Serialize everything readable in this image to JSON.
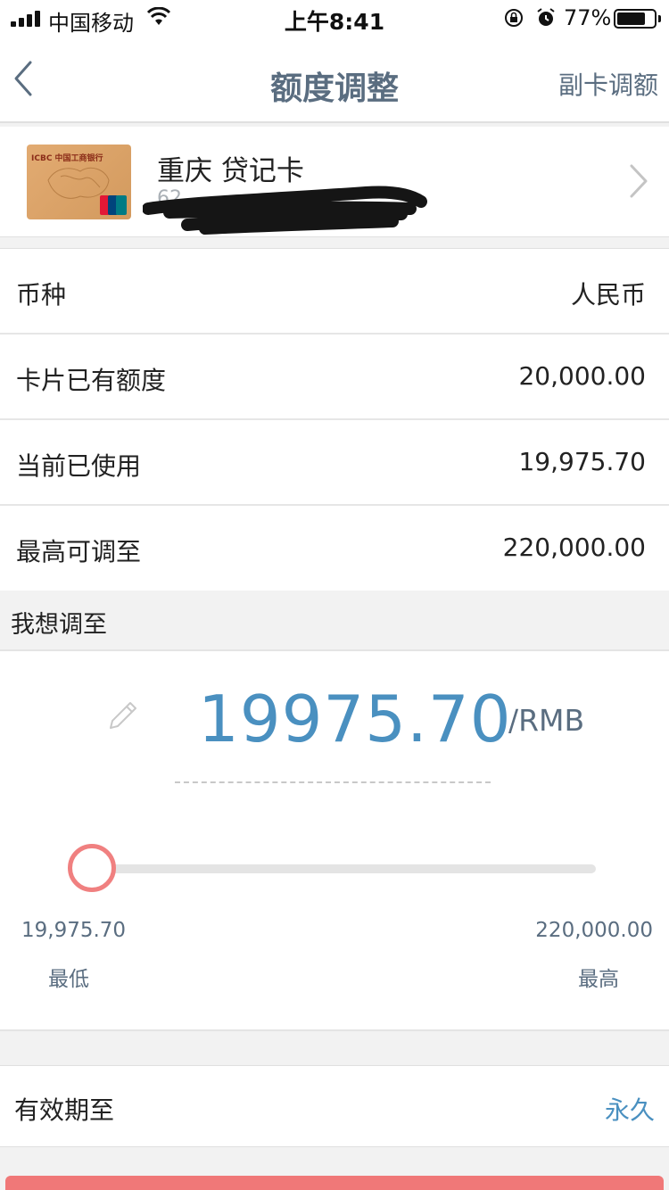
{
  "status_bar": {
    "carrier": "中国移动",
    "time": "上午8:41",
    "battery_percent": "77%",
    "battery_level": 0.77,
    "icons": [
      "signal-icon",
      "wifi-icon",
      "orientation-lock-icon",
      "alarm-icon",
      "battery-icon"
    ]
  },
  "nav": {
    "title": "额度调整",
    "right_action": "副卡调额",
    "back_icon": "chevron-left-icon"
  },
  "card": {
    "name": "重庆 贷记卡",
    "number_visible": "62",
    "number_redacted": true,
    "chevron_icon": "chevron-right-icon"
  },
  "info": {
    "rows": [
      {
        "label": "币种",
        "value": "人民币"
      },
      {
        "label": "卡片已有额度",
        "value": "20,000.00"
      },
      {
        "label": "当前已使用",
        "value": "19,975.70"
      },
      {
        "label": "最高可调至",
        "value": "220,000.00"
      }
    ]
  },
  "adjust": {
    "section_title": "我想调至",
    "amount": "19975.70",
    "unit": "/RMB",
    "edit_icon": "pencil-icon",
    "slider_position": 0,
    "min_value": "19,975.70",
    "max_value": "220,000.00",
    "min_label": "最低",
    "max_label": "最高"
  },
  "validity": {
    "label": "有效期至",
    "value": "永久"
  },
  "colors": {
    "accent_blue": "#4a90c0",
    "nav_gray": "#5a6d80",
    "slider_red": "#f08080"
  }
}
